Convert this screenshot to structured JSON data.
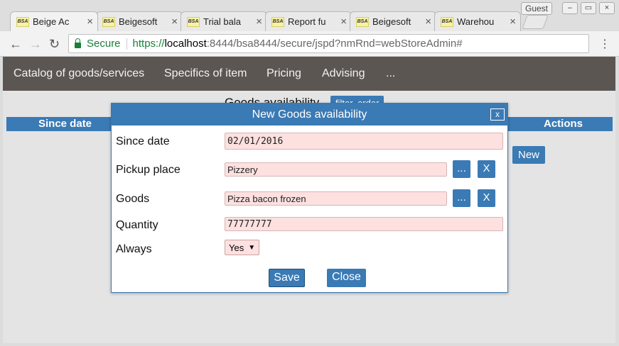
{
  "browser": {
    "tabs": [
      {
        "favicon": "BSA",
        "title": "Beige Ac",
        "active": true
      },
      {
        "favicon": "BSA",
        "title": "Beigesoft"
      },
      {
        "favicon": "BSA",
        "title": "Trial bala"
      },
      {
        "favicon": "BSA",
        "title": "Report fu"
      },
      {
        "favicon": "BSA",
        "title": "Beigesoft"
      },
      {
        "favicon": "BSA",
        "title": "Warehou"
      }
    ],
    "profile": "Guest",
    "secure_label": "Secure",
    "url_scheme": "https://",
    "url_host": "localhost",
    "url_rest": ":8444/bsa8444/secure/jspd?nmRnd=webStoreAdmin#"
  },
  "navbar": {
    "items": [
      "Catalog of goods/services",
      "Specifics of item",
      "Pricing",
      "Advising",
      "..."
    ]
  },
  "page": {
    "title": "Goods availability",
    "filter_button": "filter, order",
    "columns": {
      "since_date": "Since date",
      "actions": "Actions"
    },
    "new_button": "New"
  },
  "dialog": {
    "title": "New Goods availability",
    "close_x": "x",
    "fields": {
      "since_date": {
        "label": "Since date",
        "value": "02/01/2016"
      },
      "pickup_place": {
        "label": "Pickup place",
        "value": "Pizzery"
      },
      "goods": {
        "label": "Goods",
        "value": "Pizza bacon frozen"
      },
      "quantity": {
        "label": "Quantity",
        "value": "77777777"
      },
      "always": {
        "label": "Always",
        "value": "Yes"
      }
    },
    "pick_button": "...",
    "clear_button": "X",
    "save_button": "Save",
    "close_button": "Close"
  },
  "colors": {
    "accent": "#3a7ab5",
    "navbar": "#5c5653",
    "field_bg": "#fde0e0"
  }
}
